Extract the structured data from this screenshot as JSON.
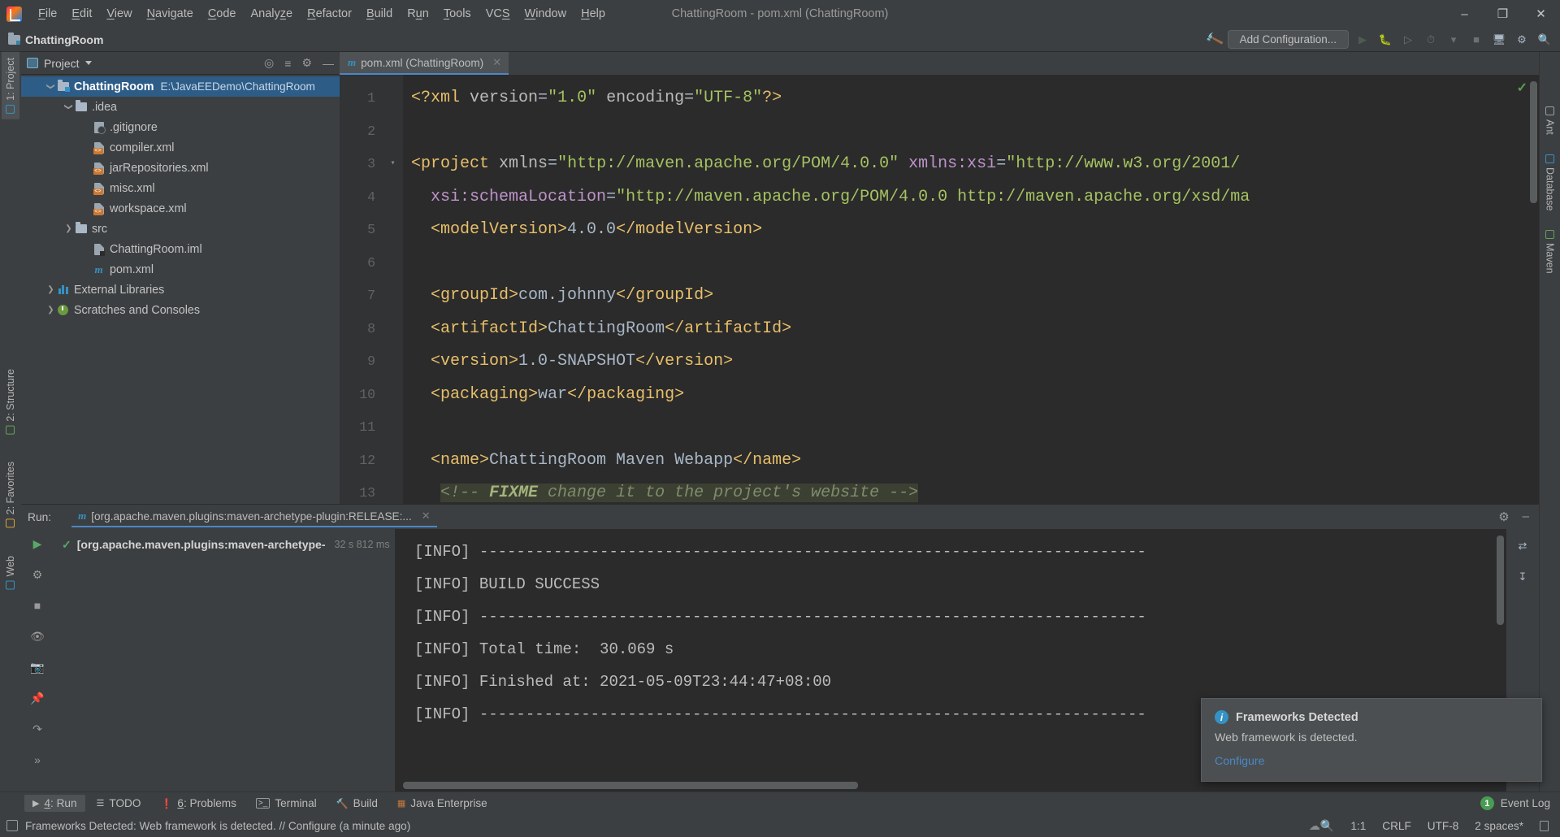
{
  "window": {
    "title": "ChattingRoom - pom.xml (ChattingRoom)",
    "minimize": "–",
    "maximize": "❐",
    "close": "✕"
  },
  "menubar": {
    "items": [
      "File",
      "Edit",
      "View",
      "Navigate",
      "Code",
      "Analyze",
      "Refactor",
      "Build",
      "Run",
      "Tools",
      "VCS",
      "Window",
      "Help"
    ]
  },
  "navbar": {
    "breadcrumb": "ChattingRoom",
    "add_configuration": "Add Configuration...",
    "icons": [
      "hammer-build-icon",
      "run-icon",
      "debug-icon",
      "run-with-coverage-icon",
      "profiler-icon",
      "stop-icon",
      "search-everywhere-icon",
      "settings-icon",
      "search-icon"
    ]
  },
  "left_stripe": {
    "tabs": [
      {
        "label": "1: Project",
        "selected": true
      },
      {
        "label": "2: Structure",
        "selected": false
      },
      {
        "label": "2: Favorites",
        "selected": false
      },
      {
        "label": "Web",
        "selected": false
      }
    ]
  },
  "right_stripe": {
    "tabs": [
      {
        "label": "Ant",
        "selected": false
      },
      {
        "label": "Database",
        "selected": false
      },
      {
        "label": "Maven",
        "selected": false
      }
    ]
  },
  "project_panel": {
    "title": "Project",
    "actions": [
      "locate-icon",
      "collapse-all-icon",
      "settings-icon",
      "hide-icon"
    ],
    "tree": [
      {
        "label": "ChattingRoom",
        "path": "E:\\JavaEEDemo\\ChattingRoom",
        "indent": 0,
        "arrow": "open",
        "icon": "module-icon",
        "selected": true,
        "bold": true
      },
      {
        "label": ".idea",
        "path": "",
        "indent": 1,
        "arrow": "open",
        "icon": "folder-icon",
        "selected": false,
        "bold": false
      },
      {
        "label": ".gitignore",
        "path": "",
        "indent": 2,
        "arrow": "none",
        "icon": "gitignore-file-icon",
        "selected": false,
        "bold": false
      },
      {
        "label": "compiler.xml",
        "path": "",
        "indent": 2,
        "arrow": "none",
        "icon": "xml-file-icon",
        "selected": false,
        "bold": false
      },
      {
        "label": "jarRepositories.xml",
        "path": "",
        "indent": 2,
        "arrow": "none",
        "icon": "xml-file-icon",
        "selected": false,
        "bold": false
      },
      {
        "label": "misc.xml",
        "path": "",
        "indent": 2,
        "arrow": "none",
        "icon": "xml-file-icon",
        "selected": false,
        "bold": false
      },
      {
        "label": "workspace.xml",
        "path": "",
        "indent": 2,
        "arrow": "none",
        "icon": "xml-file-icon",
        "selected": false,
        "bold": false
      },
      {
        "label": "src",
        "path": "",
        "indent": 1,
        "arrow": "closed",
        "icon": "folder-icon",
        "selected": false,
        "bold": false
      },
      {
        "label": "ChattingRoom.iml",
        "path": "",
        "indent": 1,
        "arrow": "none",
        "icon": "iml-file-icon",
        "selected": false,
        "bold": false
      },
      {
        "label": "pom.xml",
        "path": "",
        "indent": 1,
        "arrow": "none",
        "icon": "maven-file-icon",
        "selected": false,
        "bold": false
      },
      {
        "label": "External Libraries",
        "path": "",
        "indent": 0,
        "arrow": "closed",
        "icon": "library-icon",
        "selected": false,
        "bold": false
      },
      {
        "label": "Scratches and Consoles",
        "path": "",
        "indent": 0,
        "arrow": "closed",
        "icon": "scratches-icon",
        "selected": false,
        "bold": false
      }
    ]
  },
  "editor": {
    "tab": {
      "label": "pom.xml (ChattingRoom)",
      "icon": "maven-icon",
      "close": "✕"
    },
    "inspection_ok": "✓",
    "lines": [
      {
        "n": "1",
        "fold": false
      },
      {
        "n": "2",
        "fold": false
      },
      {
        "n": "3",
        "fold": true
      },
      {
        "n": "4",
        "fold": false
      },
      {
        "n": "5",
        "fold": false
      },
      {
        "n": "6",
        "fold": false
      },
      {
        "n": "7",
        "fold": false
      },
      {
        "n": "8",
        "fold": false
      },
      {
        "n": "9",
        "fold": false
      },
      {
        "n": "10",
        "fold": false
      },
      {
        "n": "11",
        "fold": false
      },
      {
        "n": "12",
        "fold": false
      },
      {
        "n": "13",
        "fold": false
      }
    ],
    "code_text": [
      "<?xml version=\"1.0\" encoding=\"UTF-8\"?>",
      "",
      "<project xmlns=\"http://maven.apache.org/POM/4.0.0\" xmlns:xsi=\"http://www.w3.org/2001/",
      "  xsi:schemaLocation=\"http://maven.apache.org/POM/4.0.0 http://maven.apache.org/xsd/ma",
      "  <modelVersion>4.0.0</modelVersion>",
      "",
      "  <groupId>com.johnny</groupId>",
      "  <artifactId>ChattingRoom</artifactId>",
      "  <version>1.0-SNAPSHOT</version>",
      "  <packaging>war</packaging>",
      "",
      "  <name>ChattingRoom Maven Webapp</name>",
      "  <!-- FIXME change it to the project's website -->"
    ]
  },
  "run_panel": {
    "label": "Run:",
    "tab_title": "[org.apache.maven.plugins:maven-archetype-plugin:RELEASE:...",
    "tab_close": "✕",
    "settings_icon": "gear-icon",
    "minimize_icon": "–",
    "tree_item": {
      "name": "[org.apache.maven.plugins:maven-archetype-",
      "time": "32 s 812 ms",
      "status": "✓"
    },
    "console_lines": [
      "[INFO] ------------------------------------------------------------------------",
      "[INFO] BUILD SUCCESS",
      "[INFO] ------------------------------------------------------------------------",
      "[INFO] Total time:  30.069 s",
      "[INFO] Finished at: 2021-05-09T23:44:47+08:00",
      "[INFO] ------------------------------------------------------------------------"
    ],
    "left_icons": [
      "rerun-icon",
      "toggle-tasks-icon",
      "stop-icon",
      "eye-icon",
      "camera-icon",
      "pin-icon",
      "export-icon",
      "more-icon"
    ],
    "right_icons": [
      "soft-wrap-icon",
      "scroll-to-end-icon"
    ]
  },
  "notification": {
    "title": "Frameworks Detected",
    "body": "Web framework is detected.",
    "link": "Configure",
    "icon": "info-icon"
  },
  "tool_buttons": {
    "items": [
      {
        "label": "4: Run",
        "icon": "play-icon",
        "selected": true
      },
      {
        "label": "TODO",
        "icon": "list-icon",
        "selected": false
      },
      {
        "label": "6: Problems",
        "icon": "error-icon",
        "selected": false
      },
      {
        "label": "Terminal",
        "icon": "terminal-icon",
        "selected": false
      },
      {
        "label": "Build",
        "icon": "hammer-icon",
        "selected": false
      },
      {
        "label": "Java Enterprise",
        "icon": "java-ee-icon",
        "selected": false
      }
    ],
    "event_log": {
      "count": "1",
      "label": "Event Log"
    }
  },
  "statusbar": {
    "message": "Frameworks Detected: Web framework is detected. // Configure (a minute ago)",
    "caret": "1:1",
    "line_separator": "CRLF",
    "encoding": "UTF-8",
    "indent": "2 spaces",
    "indent_star": "*",
    "db_icon": "database-icon",
    "lock_icon": "lock-icon"
  },
  "colors": {
    "accent_blue": "#4a88c7",
    "selection_blue": "#2d5c87",
    "success_green": "#59a869",
    "panel_bg": "#3c3f41",
    "editor_bg": "#2b2b2b",
    "tag_orange": "#e8bf6a",
    "string_green": "#a5c261"
  }
}
